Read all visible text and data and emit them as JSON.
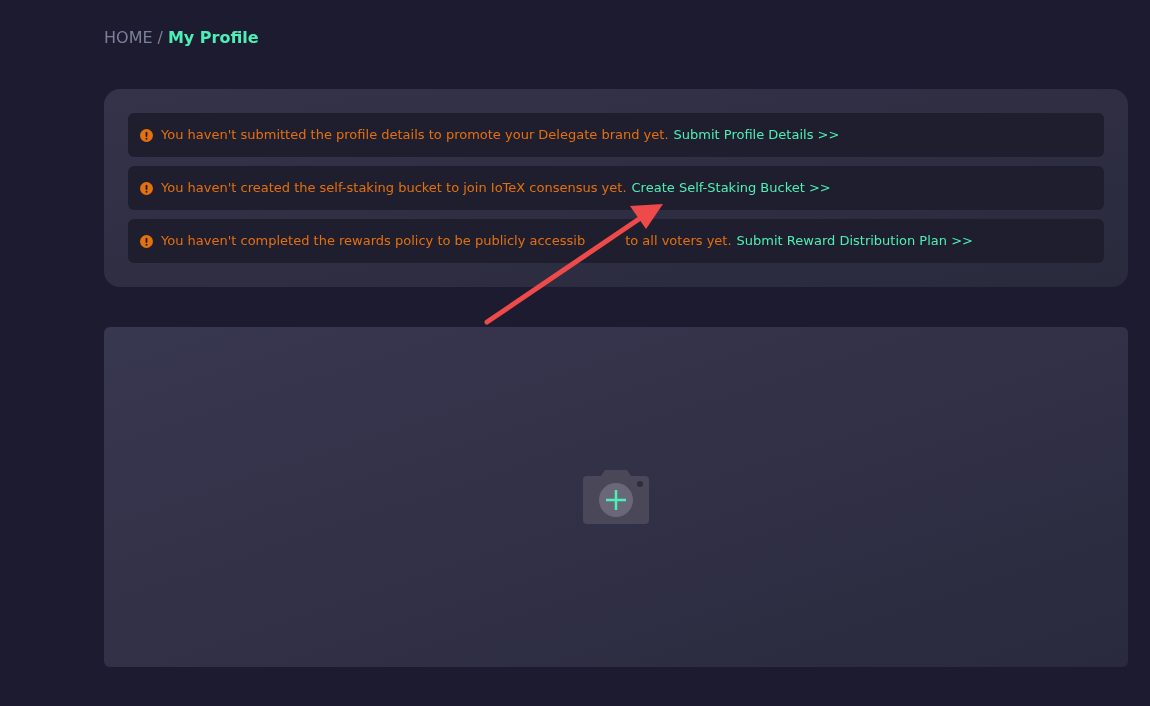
{
  "breadcrumb": [
    {
      "label": "HOME",
      "selected": false
    },
    {
      "label": "My Profile",
      "selected": true
    }
  ],
  "breadcrumb_separator": "/",
  "alerts": [
    {
      "message": "You haven't submitted the profile details to promote your Delegate brand yet.",
      "link": "Submit Profile Details >>"
    },
    {
      "message": "You haven't created the self-staking bucket to join IoTeX consensus yet.",
      "link": "Create Self-Staking Bucket >>"
    },
    {
      "message": "You haven't completed the rewards policy to be publicly accessib",
      "message_after_arrow": "to all voters yet.",
      "link": "Submit Reward Distribution Plan >>"
    }
  ],
  "upload": {
    "kind": "photo"
  }
}
